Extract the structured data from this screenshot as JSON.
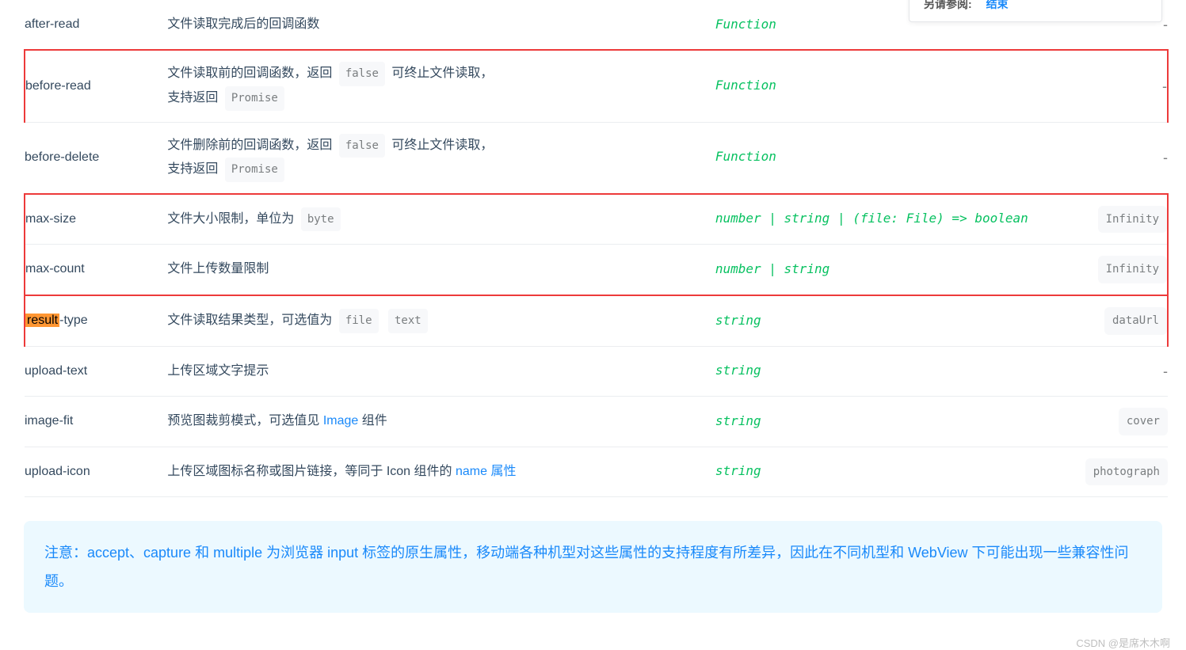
{
  "sidecard": {
    "label": "另请参阅:",
    "link": "结束"
  },
  "rows": [
    {
      "name": "after-read",
      "desc_parts": [
        {
          "t": "text",
          "v": "文件读取完成后的回调函数"
        }
      ],
      "type_parts": [
        {
          "t": "italic",
          "v": "Function"
        }
      ],
      "default_parts": [
        {
          "t": "dash",
          "v": "-"
        }
      ],
      "boxed": false
    },
    {
      "name": "before-read",
      "desc_parts": [
        {
          "t": "text",
          "v": "文件读取前的回调函数，返回 "
        },
        {
          "t": "code",
          "v": "false"
        },
        {
          "t": "text",
          "v": " 可终止文件读取，"
        },
        {
          "t": "br"
        },
        {
          "t": "text",
          "v": "支持返回 "
        },
        {
          "t": "code",
          "v": "Promise"
        }
      ],
      "type_parts": [
        {
          "t": "italic",
          "v": "Function"
        }
      ],
      "default_parts": [
        {
          "t": "dash",
          "v": "-"
        }
      ],
      "boxed": true
    },
    {
      "name": "before-delete",
      "desc_parts": [
        {
          "t": "text",
          "v": "文件删除前的回调函数，返回 "
        },
        {
          "t": "code",
          "v": "false"
        },
        {
          "t": "text",
          "v": " 可终止文件读取，"
        },
        {
          "t": "br"
        },
        {
          "t": "text",
          "v": "支持返回 "
        },
        {
          "t": "code",
          "v": "Promise"
        }
      ],
      "type_parts": [
        {
          "t": "italic",
          "v": "Function"
        }
      ],
      "default_parts": [
        {
          "t": "dash",
          "v": "-"
        }
      ],
      "boxed": false
    },
    {
      "name": "max-size",
      "desc_parts": [
        {
          "t": "text",
          "v": "文件大小限制，单位为 "
        },
        {
          "t": "code",
          "v": "byte"
        }
      ],
      "type_parts": [
        {
          "t": "italic",
          "v": "number | string | (file: File) => boolean"
        }
      ],
      "default_parts": [
        {
          "t": "codebox",
          "v": "Infinity"
        }
      ],
      "boxed": true,
      "box_group": "a"
    },
    {
      "name": "max-count",
      "desc_parts": [
        {
          "t": "text",
          "v": "文件上传数量限制"
        }
      ],
      "type_parts": [
        {
          "t": "italic",
          "v": "number | string"
        }
      ],
      "default_parts": [
        {
          "t": "codebox",
          "v": "Infinity"
        }
      ],
      "boxed": true,
      "box_group": "a"
    },
    {
      "name_parts": [
        {
          "t": "mark",
          "v": "result"
        },
        {
          "t": "text",
          "v": "-type"
        }
      ],
      "desc_parts": [
        {
          "t": "text",
          "v": "文件读取结果类型，可选值为 "
        },
        {
          "t": "code",
          "v": "file"
        },
        {
          "t": "text",
          "v": " "
        },
        {
          "t": "code",
          "v": "text"
        }
      ],
      "type_parts": [
        {
          "t": "italic",
          "v": "string"
        }
      ],
      "default_parts": [
        {
          "t": "codebox",
          "v": "dataUrl"
        }
      ],
      "boxed": true
    },
    {
      "name": "upload-text",
      "desc_parts": [
        {
          "t": "text",
          "v": "上传区域文字提示"
        }
      ],
      "type_parts": [
        {
          "t": "italic",
          "v": "string"
        }
      ],
      "default_parts": [
        {
          "t": "dash",
          "v": "-"
        }
      ],
      "boxed": false
    },
    {
      "name": "image-fit",
      "desc_parts": [
        {
          "t": "text",
          "v": "预览图裁剪模式，可选值见 "
        },
        {
          "t": "link",
          "v": "Image"
        },
        {
          "t": "text",
          "v": " 组件"
        }
      ],
      "type_parts": [
        {
          "t": "italic",
          "v": "string"
        }
      ],
      "default_parts": [
        {
          "t": "codebox",
          "v": "cover"
        }
      ],
      "boxed": false
    },
    {
      "name": "upload-icon",
      "desc_parts": [
        {
          "t": "text",
          "v": "上传区域图标名称或图片链接，等同于 Icon 组件的 "
        },
        {
          "t": "link",
          "v": "name 属性"
        }
      ],
      "type_parts": [
        {
          "t": "italic",
          "v": "string"
        }
      ],
      "default_parts": [
        {
          "t": "codebox",
          "v": "photograph"
        }
      ],
      "boxed": false
    }
  ],
  "note": "注意：accept、capture 和 multiple 为浏览器 input 标签的原生属性，移动端各种机型对这些属性的支持程度有所差异，因此在不同机型和 WebView 下可能出现一些兼容性问题。",
  "watermark": "CSDN @是席木木啊"
}
